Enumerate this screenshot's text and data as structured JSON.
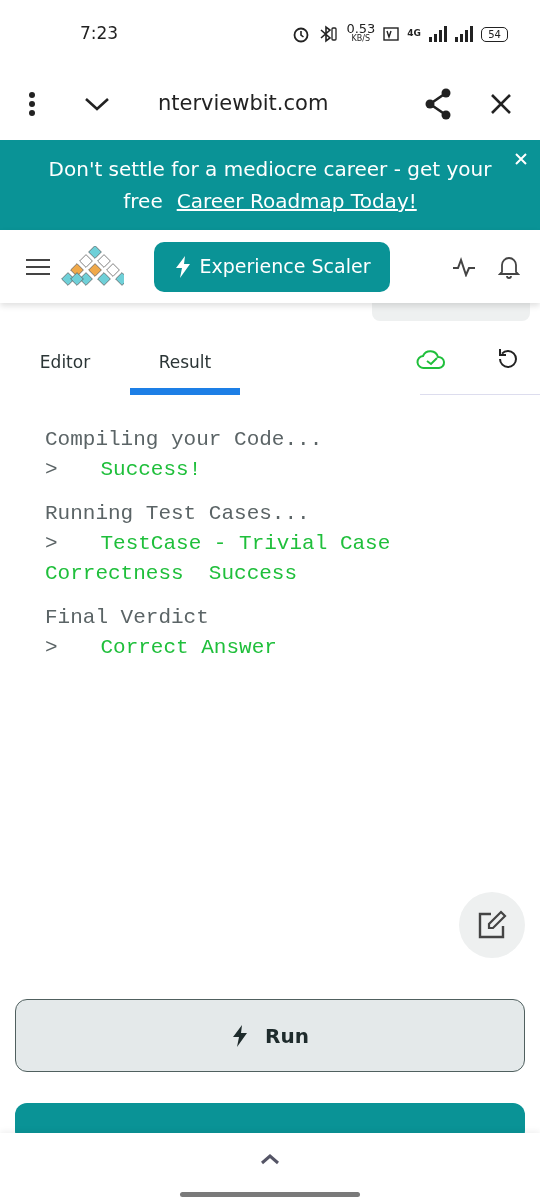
{
  "status_bar": {
    "time": "7:23",
    "network_speed": "0.53",
    "speed_unit": "KB/S",
    "network_type": "4G",
    "battery": "54"
  },
  "browser_bar": {
    "url": "nterviewbit.com"
  },
  "banner": {
    "text": "Don't settle for a mediocre career - get your free",
    "link": "Career Roadmap Today!"
  },
  "nav": {
    "cta": "Experience Scaler"
  },
  "tabs": [
    {
      "label": "Editor",
      "selected": false
    },
    {
      "label": "Result",
      "selected": true
    }
  ],
  "output": [
    {
      "kind": "heading",
      "text": "Compiling your Code..."
    },
    {
      "kind": "result",
      "prompt": ">",
      "text": "Success!"
    },
    {
      "kind": "heading",
      "text": "Running Test Cases..."
    },
    {
      "kind": "result",
      "prompt": ">",
      "text": "TestCase - Trivial Case Correctness  Success"
    },
    {
      "kind": "heading",
      "text": "Final Verdict"
    },
    {
      "kind": "result",
      "prompt": ">",
      "text": "Correct Answer"
    }
  ],
  "buttons": {
    "run": "Run"
  }
}
